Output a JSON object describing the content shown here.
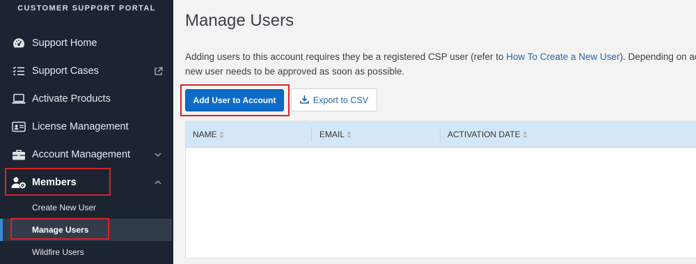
{
  "sidebar": {
    "portal_title": "CUSTOMER SUPPORT PORTAL",
    "items": [
      {
        "label": "Support Home",
        "icon": "dashboard-icon"
      },
      {
        "label": "Support Cases",
        "icon": "list-check-icon",
        "right_icon": "external-link-icon"
      },
      {
        "label": "Activate Products",
        "icon": "laptop-icon"
      },
      {
        "label": "License Management",
        "icon": "license-card-icon"
      },
      {
        "label": "Account Management",
        "icon": "briefcase-icon",
        "right_icon": "chevron-down-icon"
      },
      {
        "label": "Members",
        "icon": "user-gear-icon",
        "right_icon": "chevron-up-icon"
      }
    ],
    "sub_items": [
      {
        "label": "Create New User"
      },
      {
        "label": "Manage Users",
        "active": true
      },
      {
        "label": "Wildfire Users"
      }
    ]
  },
  "main": {
    "title": "Manage Users",
    "desc_prefix": "Adding users to this account requires they be a registered CSP user (refer to ",
    "desc_link": "How To Create a New User",
    "desc_suffix": "). Depending on ac",
    "desc_line2": "new user needs to be approved as soon as possible.",
    "add_button": "Add User to Account",
    "export_button": "Export to CSV",
    "table": {
      "columns": [
        "NAME",
        "EMAIL",
        "ACTIVATION DATE"
      ],
      "rows": []
    }
  },
  "colors": {
    "sidebar_bg": "#1c2431",
    "accent": "#0c6bc8",
    "highlight": "#d7222a",
    "table_header": "#d4e7f8"
  }
}
